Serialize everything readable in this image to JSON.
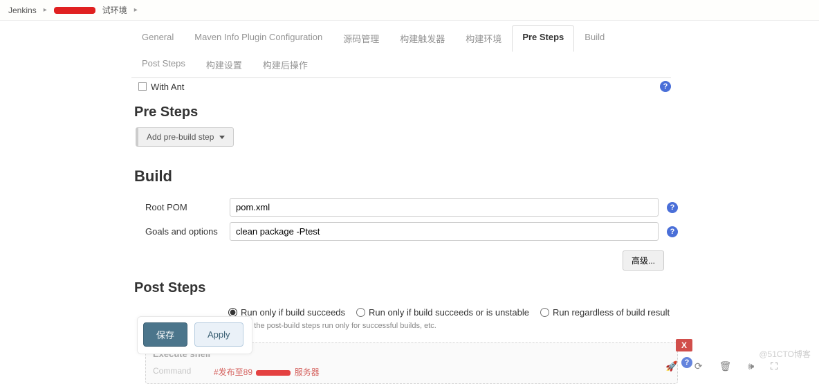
{
  "breadcrumb": {
    "root": "Jenkins",
    "suffix": "试环境"
  },
  "tabs": {
    "general": "General",
    "maven_info": "Maven Info Plugin Configuration",
    "scm": "源码管理",
    "triggers": "构建触发器",
    "env": "构建环境",
    "pre_steps": "Pre Steps",
    "build": "Build",
    "post_steps": "Post Steps",
    "build_settings": "构建设置",
    "post_build": "构建后操作"
  },
  "withant": {
    "label": "With Ant"
  },
  "pre_steps": {
    "title": "Pre Steps",
    "add_button": "Add pre-build step"
  },
  "build": {
    "title": "Build",
    "root_pom_label": "Root POM",
    "root_pom_value": "pom.xml",
    "goals_label": "Goals and options",
    "goals_value": "clean package -Ptest",
    "advanced": "高级..."
  },
  "post_steps": {
    "title": "Post Steps",
    "radio_success": "Run only if build succeeds",
    "radio_unstable": "Run only if build succeeds or is unstable",
    "radio_always": "Run regardless of build result",
    "hint": "Should the post-build steps run only for successful builds, etc.",
    "exec_shell_title": "Execute shell",
    "command_label": "Command",
    "command_prefix": "#发布至89",
    "command_suffix": "服务器",
    "close": "X"
  },
  "footer": {
    "save": "保存",
    "apply": "Apply"
  },
  "watermark": "@51CTO博客"
}
